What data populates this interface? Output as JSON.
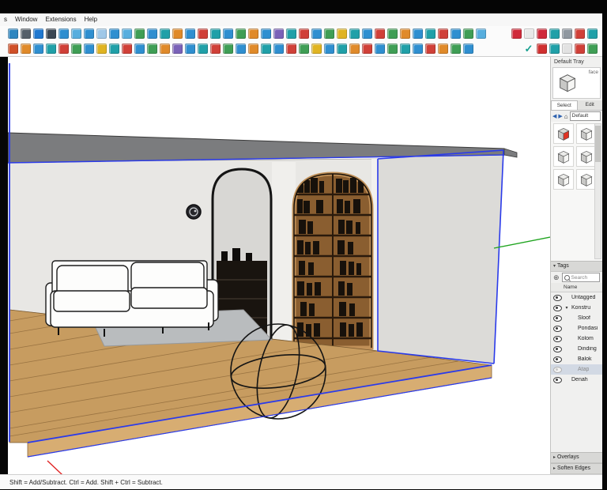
{
  "menu": {
    "items": [
      "s",
      "Window",
      "Extensions",
      "Help"
    ]
  },
  "toolbar": {
    "row1": [
      "#2e86c0",
      "#56606a",
      "#1f78d0",
      "#3b4754",
      "#2f8fd0",
      "#57aede",
      "#2f8fd0",
      "#9fc8e8",
      "#2f8fd0",
      "#57aede",
      "#3f9e55",
      "#2f8fd0",
      "#20a0a8",
      "#e08a2a",
      "#2f8fd0",
      "#d04038",
      "#20a0a8",
      "#2f8fd0",
      "#3f9e55",
      "#e08a2a",
      "#2f8fd0",
      "#7a62b8",
      "#20a0a8",
      "#d04038",
      "#2f8fd0",
      "#3f9e55",
      "#e0b422",
      "#20a0a8",
      "#2f8fd0",
      "#d04038",
      "#3f9e55",
      "#e08a2a",
      "#2f8fd0",
      "#20a0a8",
      "#d04038",
      "#2f8fd0",
      "#3f9e55",
      "#57aede"
    ],
    "row1_right": [
      "#d02a3a",
      "#e8e8e8",
      "#d02a3a",
      "#20a0a8",
      "#9098a0",
      "#d04038",
      "#20a0a8"
    ],
    "row2": [
      "#d05028",
      "#e08a2a",
      "#2f8fd0",
      "#20a0a8",
      "#d04038",
      "#3f9e55",
      "#2f8fd0",
      "#e0b422",
      "#20a0a8",
      "#d04038",
      "#2f8fd0",
      "#3f9e55",
      "#e08a2a",
      "#7a62b8",
      "#2f8fd0",
      "#20a0a8",
      "#d04038",
      "#3f9e55",
      "#2f8fd0",
      "#e08a2a",
      "#20a0a8",
      "#2f8fd0",
      "#d04038",
      "#3f9e55",
      "#e0b422",
      "#2f8fd0",
      "#20a0a8",
      "#e08a2a",
      "#d04038",
      "#2f8fd0",
      "#3f9e55",
      "#20a0a8",
      "#2f8fd0",
      "#d04038",
      "#e08a2a",
      "#3f9e55",
      "#2f8fd0"
    ],
    "row2_right": [
      {
        "g": "✓",
        "c": "#18a090"
      },
      "#d03030",
      "#20a0a8",
      "#e2e2e2",
      "#d04038",
      "#3f9e55"
    ]
  },
  "tray": {
    "title": "Default Tray",
    "preview_label": "face",
    "tabs": [
      "Select",
      "Edit"
    ],
    "nav": {
      "back": "◀",
      "fwd": "▶",
      "home": "⌂",
      "dropdown": "Default"
    },
    "components": [
      {
        "highlight": true
      },
      {
        "highlight": false
      },
      {
        "highlight": false
      },
      {
        "highlight": false
      },
      {
        "highlight": false
      },
      {
        "highlight": false
      }
    ],
    "tags": {
      "header": "Tags",
      "search_placeholder": "Search",
      "name_header": "Name",
      "items": [
        {
          "name": "Untagged",
          "level": 0,
          "visible": true,
          "expanded": false,
          "selected": false
        },
        {
          "name": "Konstru",
          "level": 0,
          "visible": true,
          "expanded": true,
          "selected": false
        },
        {
          "name": "Sloof",
          "level": 1,
          "visible": true,
          "expanded": false,
          "selected": false
        },
        {
          "name": "Pondasi",
          "level": 1,
          "visible": true,
          "expanded": false,
          "selected": false
        },
        {
          "name": "Kolom",
          "level": 1,
          "visible": true,
          "expanded": false,
          "selected": false
        },
        {
          "name": "Dinding",
          "level": 1,
          "visible": true,
          "expanded": false,
          "selected": false
        },
        {
          "name": "Balok",
          "level": 1,
          "visible": true,
          "expanded": false,
          "selected": false
        },
        {
          "name": "Atap",
          "level": 1,
          "visible": false,
          "expanded": false,
          "selected": true
        },
        {
          "name": "Denah",
          "level": 0,
          "visible": true,
          "expanded": false,
          "selected": false
        }
      ]
    },
    "sections": [
      "Overlays",
      "Soften Edges"
    ]
  },
  "statusbar": {
    "hint": "Shift = Add/Subtract. Ctrl = Add. Shift + Ctrl = Subtract."
  },
  "colors": {
    "selection_blue": "#2b3bea",
    "axis_red": "#e02525",
    "axis_green": "#1fa41f",
    "floor_wood": "#c79c60",
    "ceiling_gray": "#7b7c7e"
  }
}
